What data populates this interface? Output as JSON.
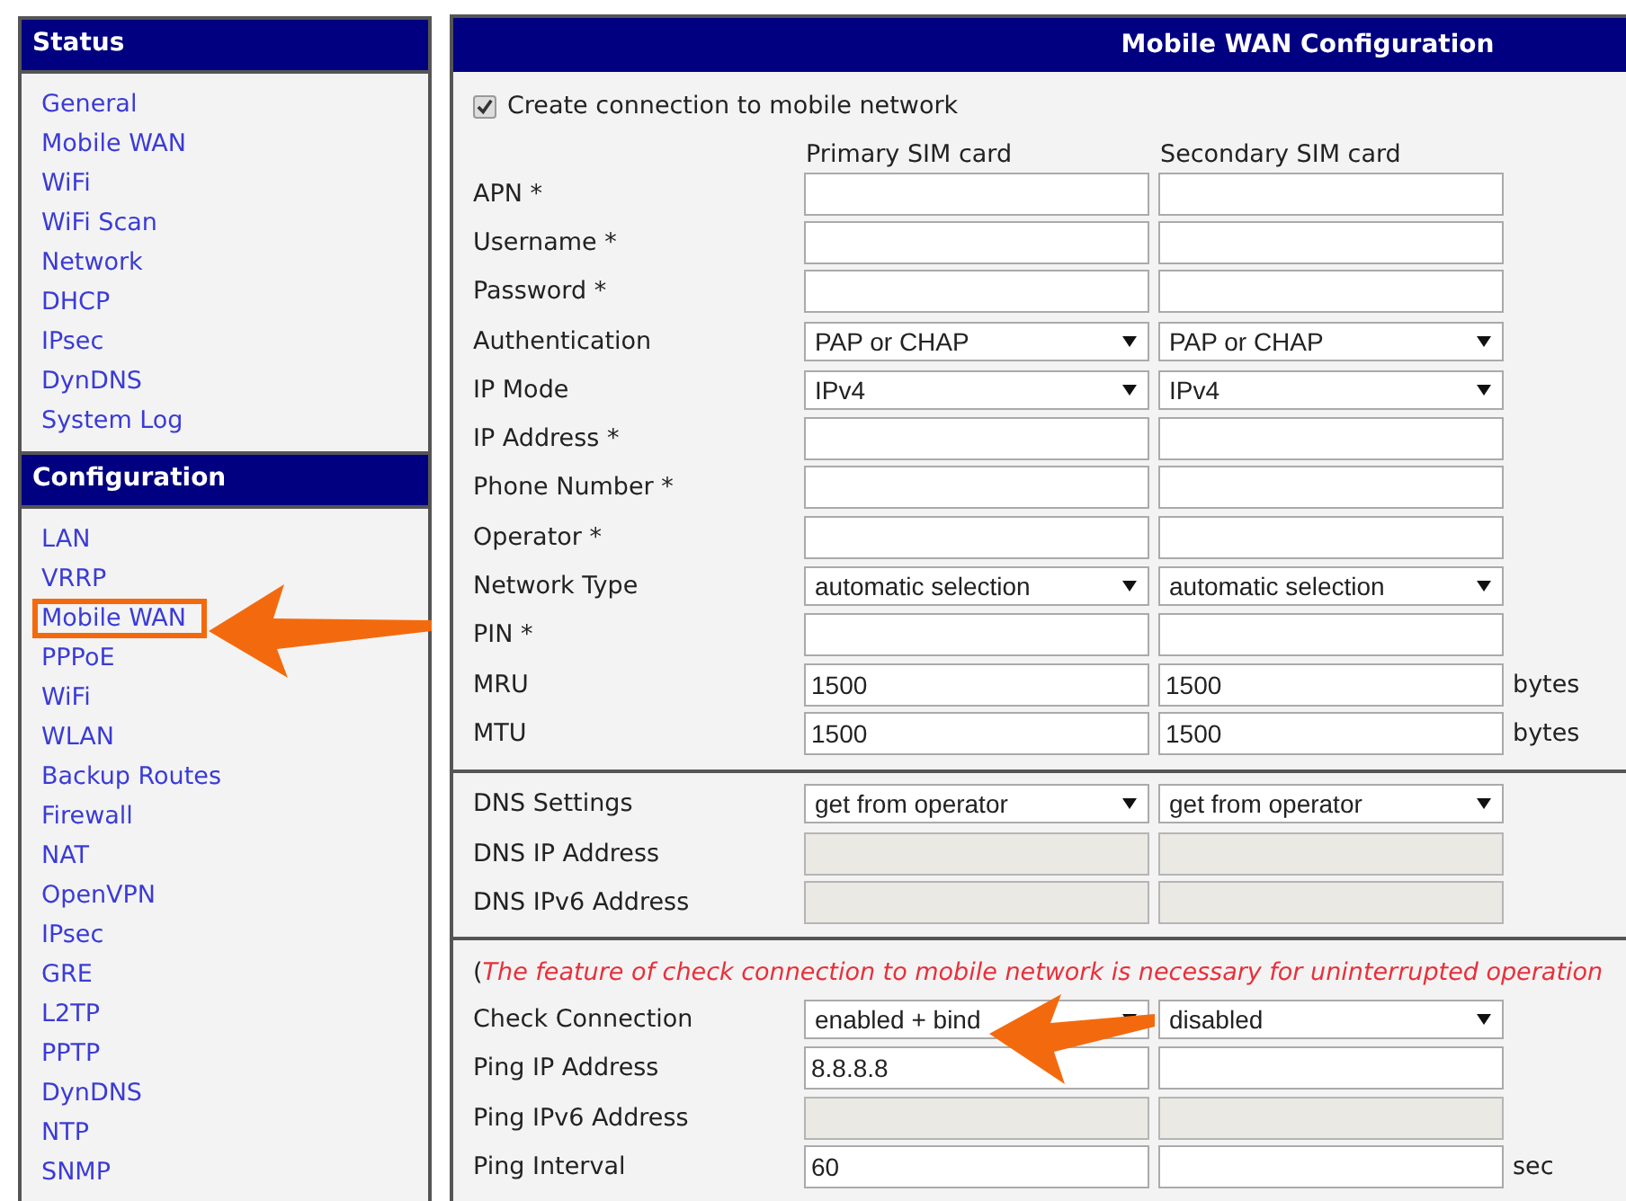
{
  "sidebar": {
    "sections": [
      {
        "title": "Status",
        "items": [
          {
            "label": "General",
            "highlighted": false
          },
          {
            "label": "Mobile WAN",
            "highlighted": false
          },
          {
            "label": "WiFi",
            "highlighted": false
          },
          {
            "label": "WiFi Scan",
            "highlighted": false
          },
          {
            "label": "Network",
            "highlighted": false
          },
          {
            "label": "DHCP",
            "highlighted": false
          },
          {
            "label": "IPsec",
            "highlighted": false
          },
          {
            "label": "DynDNS",
            "highlighted": false
          },
          {
            "label": "System Log",
            "highlighted": false
          }
        ]
      },
      {
        "title": "Configuration",
        "items": [
          {
            "label": "LAN",
            "highlighted": false
          },
          {
            "label": "VRRP",
            "highlighted": false
          },
          {
            "label": "Mobile WAN",
            "highlighted": true
          },
          {
            "label": "PPPoE",
            "highlighted": false
          },
          {
            "label": "WiFi",
            "highlighted": false
          },
          {
            "label": "WLAN",
            "highlighted": false
          },
          {
            "label": "Backup Routes",
            "highlighted": false
          },
          {
            "label": "Firewall",
            "highlighted": false
          },
          {
            "label": "NAT",
            "highlighted": false
          },
          {
            "label": "OpenVPN",
            "highlighted": false
          },
          {
            "label": "IPsec",
            "highlighted": false
          },
          {
            "label": "GRE",
            "highlighted": false
          },
          {
            "label": "L2TP",
            "highlighted": false
          },
          {
            "label": "PPTP",
            "highlighted": false
          },
          {
            "label": "DynDNS",
            "highlighted": false
          },
          {
            "label": "NTP",
            "highlighted": false
          },
          {
            "label": "SNMP",
            "highlighted": false
          }
        ]
      }
    ]
  },
  "panel": {
    "title": "Mobile WAN Configuration",
    "create_connection": {
      "label": "Create connection to mobile network",
      "checked": true
    },
    "columns": [
      "Primary SIM card",
      "Secondary SIM card"
    ],
    "sections": [
      {
        "rows": [
          {
            "label": "APN *",
            "fields": [
              {
                "kind": "text"
              },
              {
                "kind": "text"
              }
            ]
          },
          {
            "label": "Username *",
            "fields": [
              {
                "kind": "text"
              },
              {
                "kind": "text"
              }
            ]
          },
          {
            "label": "Password *",
            "fields": [
              {
                "kind": "text"
              },
              {
                "kind": "text"
              }
            ]
          },
          {
            "label": "Authentication",
            "fields": [
              {
                "kind": "select",
                "value": "PAP or CHAP"
              },
              {
                "kind": "select",
                "value": "PAP or CHAP"
              }
            ]
          },
          {
            "label": "IP Mode",
            "fields": [
              {
                "kind": "select",
                "value": "IPv4"
              },
              {
                "kind": "select",
                "value": "IPv4"
              }
            ]
          },
          {
            "label": "IP Address *",
            "fields": [
              {
                "kind": "text"
              },
              {
                "kind": "text"
              }
            ]
          },
          {
            "label": "Phone Number *",
            "fields": [
              {
                "kind": "text"
              },
              {
                "kind": "text"
              }
            ]
          },
          {
            "label": "Operator *",
            "fields": [
              {
                "kind": "text"
              },
              {
                "kind": "text"
              }
            ]
          },
          {
            "label": "Network Type",
            "fields": [
              {
                "kind": "select",
                "value": "automatic selection"
              },
              {
                "kind": "select",
                "value": "automatic selection"
              }
            ]
          },
          {
            "label": "PIN *",
            "fields": [
              {
                "kind": "text"
              },
              {
                "kind": "text"
              }
            ]
          },
          {
            "label": "MRU",
            "fields": [
              {
                "kind": "text",
                "value": "1500"
              },
              {
                "kind": "text",
                "value": "1500"
              }
            ],
            "unit": "bytes"
          },
          {
            "label": "MTU",
            "fields": [
              {
                "kind": "text",
                "value": "1500"
              },
              {
                "kind": "text",
                "value": "1500"
              }
            ],
            "unit": "bytes"
          }
        ]
      },
      {
        "rows": [
          {
            "label": "DNS Settings",
            "fields": [
              {
                "kind": "select",
                "value": "get from operator"
              },
              {
                "kind": "select",
                "value": "get from operator"
              }
            ]
          },
          {
            "label": "DNS IP Address",
            "fields": [
              {
                "kind": "disabled"
              },
              {
                "kind": "disabled"
              }
            ]
          },
          {
            "label": "DNS IPv6 Address",
            "fields": [
              {
                "kind": "disabled"
              },
              {
                "kind": "disabled"
              }
            ]
          }
        ]
      },
      {
        "note": "(*The feature of check connection to mobile network is necessary for uninterrupted operation*",
        "rows": [
          {
            "label": "Check Connection",
            "fields": [
              {
                "kind": "select",
                "value": "enabled + bind"
              },
              {
                "kind": "select",
                "value": "disabled"
              }
            ]
          },
          {
            "label": "Ping IP Address",
            "fields": [
              {
                "kind": "text",
                "value": "8.8.8.8"
              },
              {
                "kind": "text"
              }
            ]
          },
          {
            "label": "Ping IPv6 Address",
            "fields": [
              {
                "kind": "disabled"
              },
              {
                "kind": "disabled"
              }
            ]
          },
          {
            "label": "Ping Interval",
            "fields": [
              {
                "kind": "text",
                "value": "60"
              },
              {
                "kind": "text"
              }
            ],
            "unit": "sec"
          }
        ]
      }
    ]
  }
}
